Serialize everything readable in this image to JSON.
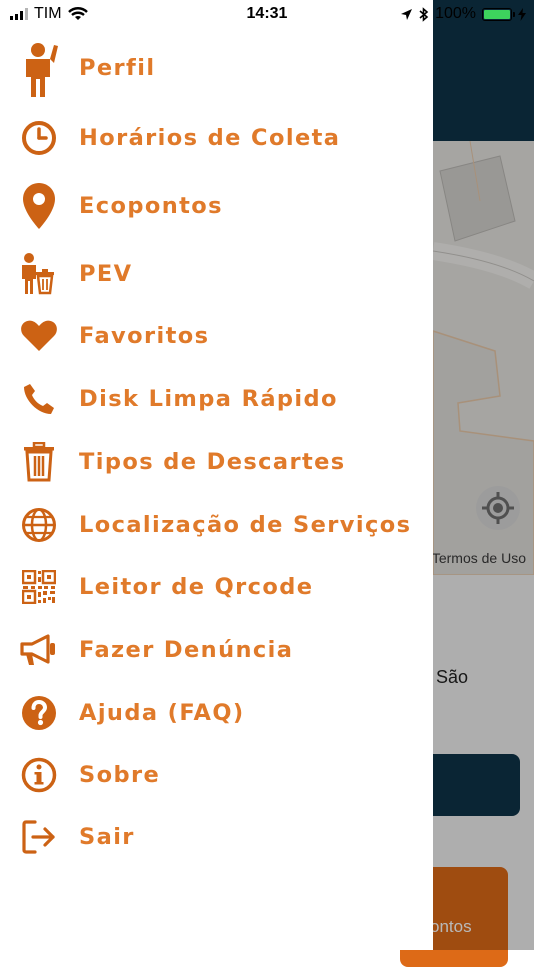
{
  "status_bar": {
    "carrier": "TIM",
    "time": "14:31",
    "battery": "100%"
  },
  "background": {
    "terms": "Termos de Uso",
    "partial_text": "São",
    "button_partial": "ontos"
  },
  "menu": {
    "items": [
      {
        "label": "Perfil",
        "icon": "person-icon"
      },
      {
        "label": "Horários de Coleta",
        "icon": "clock-icon"
      },
      {
        "label": "Ecopontos",
        "icon": "map-pin-icon"
      },
      {
        "label": "PEV",
        "icon": "person-trash-icon"
      },
      {
        "label": "Favoritos",
        "icon": "heart-icon"
      },
      {
        "label": "Disk Limpa Rápido",
        "icon": "phone-icon"
      },
      {
        "label": "Tipos de Descartes",
        "icon": "trash-icon"
      },
      {
        "label": "Localização de Serviços",
        "icon": "globe-icon"
      },
      {
        "label": "Leitor de Qrcode",
        "icon": "qrcode-icon"
      },
      {
        "label": "Fazer Denúncia",
        "icon": "megaphone-icon"
      },
      {
        "label": "Ajuda (FAQ)",
        "icon": "question-icon"
      },
      {
        "label": "Sobre",
        "icon": "info-icon"
      },
      {
        "label": "Sair",
        "icon": "sign-out-icon"
      }
    ]
  },
  "colors": {
    "accent": "#e07a2a",
    "icon": "#cc6214",
    "header": "#0f3448"
  }
}
